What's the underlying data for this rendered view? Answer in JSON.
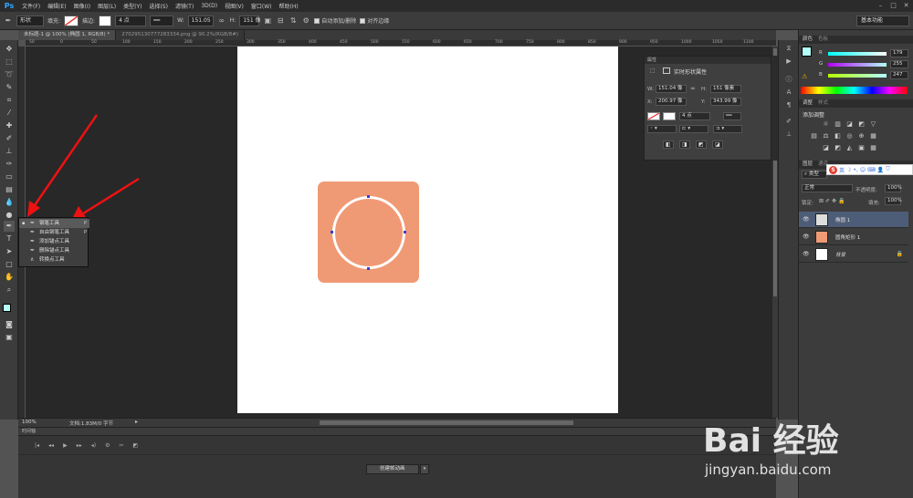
{
  "app": {
    "logo": "Ps"
  },
  "menu": [
    "文件(F)",
    "编辑(E)",
    "图像(I)",
    "图层(L)",
    "类型(Y)",
    "选择(S)",
    "滤镜(T)",
    "3D(D)",
    "视图(V)",
    "窗口(W)",
    "帮助(H)"
  ],
  "options": {
    "mode": "形状",
    "fill_label": "填充:",
    "stroke_label": "描边:",
    "stroke_width": "4 点",
    "w_label": "W:",
    "w_value": "151.05",
    "h_label": "H:",
    "h_value": "151 像",
    "auto_add": "自动添加/删除",
    "align_edges": "对齐边缘",
    "workspace": "基本功能"
  },
  "tabs": [
    {
      "label": "未标题-1 @ 100% (椭圆 1, RGB/8) *"
    },
    {
      "label": "270295130777283334.png @ 90.2%(RGB/8#)"
    }
  ],
  "ruler_top": [
    "50",
    "0",
    "50",
    "100",
    "150",
    "200",
    "250",
    "300",
    "350",
    "400",
    "450",
    "500",
    "550",
    "600",
    "650",
    "700",
    "750",
    "800",
    "850",
    "900",
    "950",
    "1000",
    "1050",
    "1100"
  ],
  "flyout": {
    "items": [
      {
        "label": "钢笔工具",
        "key": "P",
        "icon": "pen-icon"
      },
      {
        "label": "自由钢笔工具",
        "key": "P",
        "icon": "freeform-pen-icon"
      },
      {
        "label": "添加锚点工具",
        "key": "",
        "icon": "add-anchor-icon"
      },
      {
        "label": "删除锚点工具",
        "key": "",
        "icon": "delete-anchor-icon"
      },
      {
        "label": "转换点工具",
        "key": "",
        "icon": "convert-point-icon"
      }
    ]
  },
  "status": {
    "zoom": "100%",
    "doc_info": "文档:1.83M/0 字节"
  },
  "timeline": {
    "title": "时间轴",
    "create_button": "创建帧动画"
  },
  "properties": {
    "title": "属性",
    "subtitle": "实时形状属性",
    "w_label": "W:",
    "w_value": "151.04 像",
    "h_label": "H:",
    "h_value": "151 像素",
    "x_label": "X:",
    "x_value": "200.97 像",
    "y_label": "Y:",
    "y_value": "343.99 像",
    "stroke_width": "4 点"
  },
  "color_panel": {
    "tab1": "颜色",
    "tab2": "色板",
    "r_label": "R",
    "r_value": "179",
    "g_label": "G",
    "g_value": "255",
    "b_label": "B",
    "b_value": "247",
    "foreground": "#b3fff7"
  },
  "adjust_panel": {
    "tab1": "调整",
    "tab2": "样式",
    "title": "添加调整"
  },
  "layers_panel": {
    "tab1": "图层",
    "tab2": "通道",
    "filter": "类型",
    "blend_mode": "正常",
    "opacity_label": "不透明度:",
    "opacity_value": "100%",
    "lock_label": "锁定:",
    "fill_label": "填充:",
    "fill_value": "100%",
    "layers": [
      {
        "name": "椭圆 1",
        "selected": true
      },
      {
        "name": "圆角矩形 1",
        "selected": false
      },
      {
        "name": "背景",
        "selected": false
      }
    ]
  },
  "ime": {
    "logo": "S",
    "mode": "英"
  },
  "colors": {
    "rect": "#f09a75",
    "canvas_bg": "#282828",
    "accent": "#31a8ff"
  },
  "watermark": {
    "brand": "Bai 经验",
    "url": "jingyan.baidu.com"
  }
}
